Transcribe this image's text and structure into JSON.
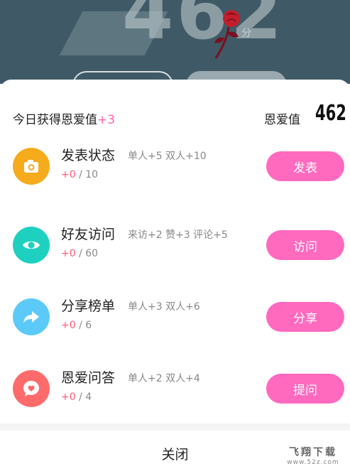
{
  "backdrop": {
    "score_big": "462",
    "unit": "分"
  },
  "header": {
    "today_label": "今日获得恩爱值",
    "today_gain": "+3",
    "score_label": "恩爱值",
    "score_value": "462"
  },
  "tasks": [
    {
      "title": "发表状态",
      "desc": "单人+5 双人+10",
      "current": "+0",
      "limit": "/ 10",
      "button": "发表",
      "icon": "camera-icon",
      "color": "#f5ab1c"
    },
    {
      "title": "好友访问",
      "desc": "来访+2 赞+3 评论+5",
      "current": "+0",
      "limit": "/ 60",
      "button": "访问",
      "icon": "eye-icon",
      "color": "#1ed0c0"
    },
    {
      "title": "分享榜单",
      "desc": "单人+3 双人+6",
      "current": "+0",
      "limit": "/ 6",
      "button": "分享",
      "icon": "share-arrow-icon",
      "color": "#5ccaf8"
    },
    {
      "title": "恩爱问答",
      "desc": "单人+2 双人+4",
      "current": "+0",
      "limit": "/ 4",
      "button": "提问",
      "icon": "heart-chat-icon",
      "color": "#ff6b6b"
    }
  ],
  "footer": {
    "close_label": "关闭"
  },
  "watermark": {
    "name": "飞翔下载",
    "url": "www.52z.com"
  },
  "colors": {
    "accent_pink": "#ff69be",
    "gain_pink": "#ff5fb4",
    "progress_red": "#ff5a78"
  }
}
